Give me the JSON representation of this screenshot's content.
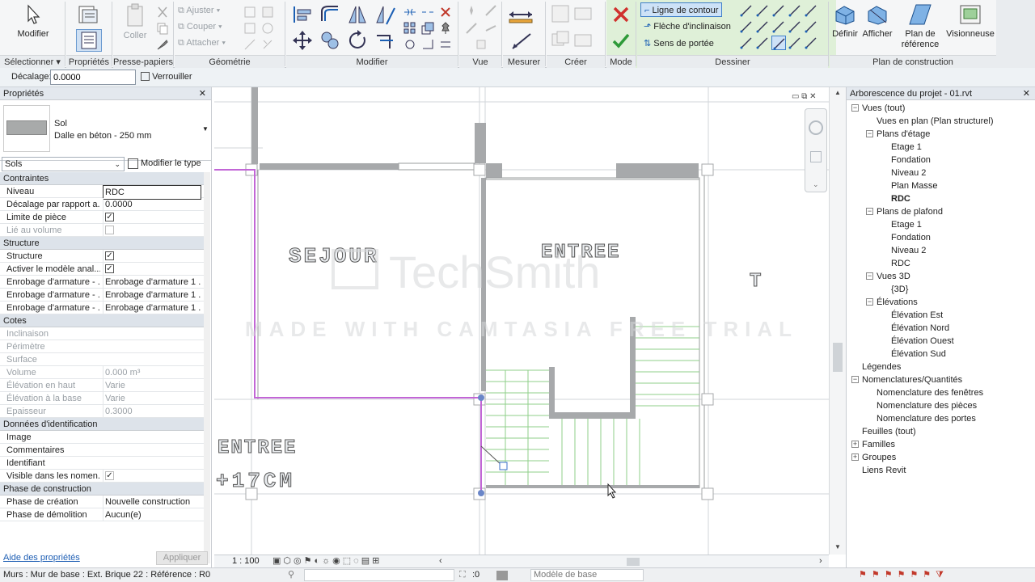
{
  "ribbon": {
    "modify_label": "Modifier",
    "select_label": "Sélectionner ▾",
    "properties_label": "Propriétés",
    "clipboard_label": "Presse-papiers",
    "paste_label": "Coller",
    "geometry_label": "Géométrie",
    "geometry_items": [
      "Ajuster",
      "Couper",
      "Attacher"
    ],
    "modify_panel_label": "Modifier",
    "view_label": "Vue",
    "measure_label": "Mesurer",
    "create_label": "Créer",
    "mode_label": "Mode",
    "draw_label": "Dessiner",
    "draw_options": [
      "Ligne de contour",
      "Flèche d'inclinaison",
      "Sens de portée"
    ],
    "workplane_label": "Plan de construction",
    "define_label": "Définir",
    "show_label": "Afficher",
    "refplane_label": "Plan de référence",
    "viewer_label": "Visionneuse"
  },
  "options_bar": {
    "offset_label": "Décalage:",
    "offset_value": "0.0000",
    "lock_label": "Verrouiller"
  },
  "properties": {
    "title": "Propriétés",
    "type_category": "Sol",
    "type_name": "Dalle en béton - 250 mm",
    "selector": "Sols",
    "edit_type": "Modifier le type",
    "sections": [
      {
        "name": "Contraintes",
        "rows": [
          {
            "k": "Niveau",
            "v": "RDC"
          },
          {
            "k": "Décalage par rapport a...",
            "v": "0.0000"
          },
          {
            "k": "Limite de pièce",
            "v": "✓"
          },
          {
            "k": "Lié au volume",
            "v": ""
          }
        ]
      },
      {
        "name": "Structure",
        "rows": [
          {
            "k": "Structure",
            "v": "✓"
          },
          {
            "k": "Activer le modèle anal...",
            "v": "✓"
          },
          {
            "k": "Enrobage d'armature - ...",
            "v": "Enrobage d'armature 1 ..."
          },
          {
            "k": "Enrobage d'armature - ...",
            "v": "Enrobage d'armature 1 ..."
          },
          {
            "k": "Enrobage d'armature - ...",
            "v": "Enrobage d'armature 1 ..."
          }
        ]
      },
      {
        "name": "Cotes",
        "rows": [
          {
            "k": "Inclinaison",
            "v": ""
          },
          {
            "k": "Périmètre",
            "v": ""
          },
          {
            "k": "Surface",
            "v": ""
          },
          {
            "k": "Volume",
            "v": "0.000 m³"
          },
          {
            "k": "Élévation en haut",
            "v": "Varie"
          },
          {
            "k": "Élévation à la base",
            "v": "Varie"
          },
          {
            "k": "Epaisseur",
            "v": "0.3000"
          }
        ]
      },
      {
        "name": "Données d'identification",
        "rows": [
          {
            "k": "Image",
            "v": ""
          },
          {
            "k": "Commentaires",
            "v": ""
          },
          {
            "k": "Identifiant",
            "v": ""
          },
          {
            "k": "Visible dans les nomen...",
            "v": "✓"
          }
        ]
      },
      {
        "name": "Phase de construction",
        "rows": [
          {
            "k": "Phase de création",
            "v": "Nouvelle construction"
          },
          {
            "k": "Phase de démolition",
            "v": "Aucun(e)"
          }
        ]
      }
    ],
    "help_link": "Aide des propriétés",
    "apply_button": "Appliquer"
  },
  "canvas": {
    "room_labels": [
      "SEJOUR",
      "ENTREE",
      "T",
      "ENTREE",
      "+17CM"
    ],
    "watermark_title": "TechSmith",
    "watermark_sub": "MADE WITH CAMTASIA FREE TRIAL",
    "scale": "1 : 100"
  },
  "browser": {
    "title": "Arborescence du projet - 01.rvt",
    "nodes": [
      {
        "label": "Vues (tout)",
        "level": 0
      },
      {
        "label": "Vues en plan (Plan structurel)",
        "level": 1
      },
      {
        "label": "Plans d'étage",
        "level": 1
      },
      {
        "label": "Etage 1",
        "level": 2
      },
      {
        "label": "Fondation",
        "level": 2
      },
      {
        "label": "Niveau 2",
        "level": 2
      },
      {
        "label": "Plan Masse",
        "level": 2
      },
      {
        "label": "RDC",
        "level": 2
      },
      {
        "label": "Plans de plafond",
        "level": 1
      },
      {
        "label": "Etage 1",
        "level": 2
      },
      {
        "label": "Fondation",
        "level": 2
      },
      {
        "label": "Niveau 2",
        "level": 2
      },
      {
        "label": "RDC",
        "level": 2
      },
      {
        "label": "Vues 3D",
        "level": 1
      },
      {
        "label": "{3D}",
        "level": 2
      },
      {
        "label": "Élévations",
        "level": 1
      },
      {
        "label": "Élévation Est",
        "level": 2
      },
      {
        "label": "Élévation Nord",
        "level": 2
      },
      {
        "label": "Élévation Ouest",
        "level": 2
      },
      {
        "label": "Élévation Sud",
        "level": 2
      },
      {
        "label": "Légendes",
        "level": 0
      },
      {
        "label": "Nomenclatures/Quantités",
        "level": 0
      },
      {
        "label": "Nomenclature des fenêtres",
        "level": 1
      },
      {
        "label": "Nomenclature des pièces",
        "level": 1
      },
      {
        "label": "Nomenclature des portes",
        "level": 1
      },
      {
        "label": "Feuilles (tout)",
        "level": 0
      },
      {
        "label": "Familles",
        "level": 0
      },
      {
        "label": "Groupes",
        "level": 0
      },
      {
        "label": "Liens Revit",
        "level": 0
      }
    ]
  },
  "status": {
    "text": "Murs : Mur de base : Ext. Brique 22 : Référence : R0",
    "count": ":0",
    "model": "Modèle de base"
  }
}
